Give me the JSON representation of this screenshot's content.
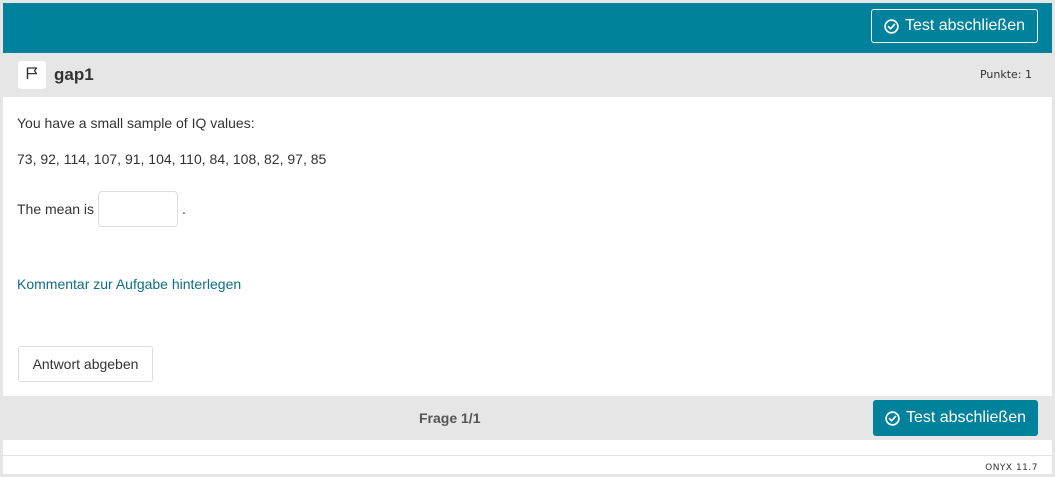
{
  "topbar": {
    "finish_label": "Test abschließen",
    "accent_color": "#00819c"
  },
  "question": {
    "title": "gap1",
    "points": "Punkte: 1",
    "intro": "You have a small sample of IQ values:",
    "values": "73, 92, 114, 107, 91, 104, 110, 84, 108, 82, 97, 85",
    "prompt_before": "The mean is",
    "prompt_after": ".",
    "answer_value": "",
    "comment_link": "Kommentar zur Aufgabe hinterlegen",
    "submit_label": "Antwort abgeben"
  },
  "footer": {
    "pager": "Frage 1/1",
    "finish_label": "Test abschließen",
    "version": "ONYX 11.7"
  },
  "icons": {
    "finish": "check-circle-icon",
    "flag": "flag-icon"
  }
}
